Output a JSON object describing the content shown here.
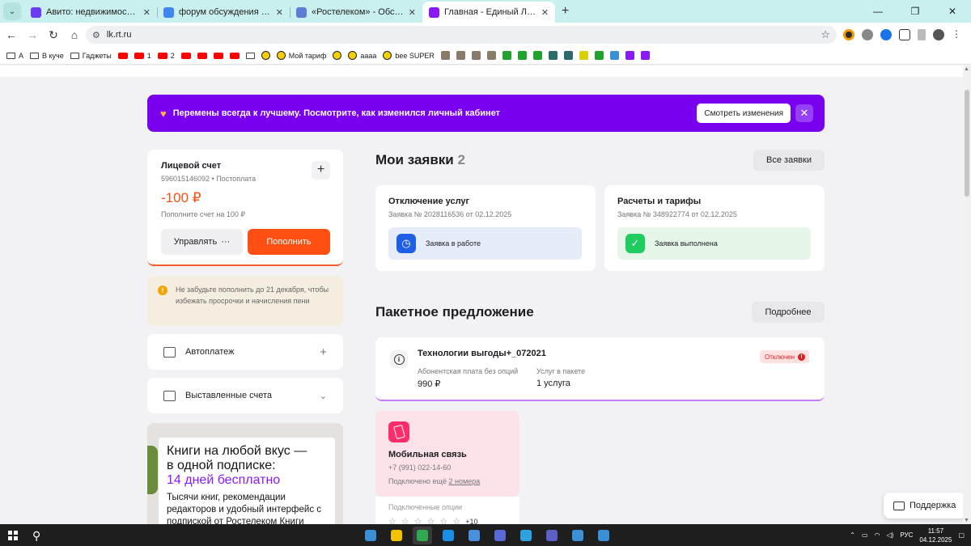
{
  "browser": {
    "tabs": [
      {
        "title": "Авито: недвижимость, транспорт",
        "fav": "#6c3cf4",
        "active": false
      },
      {
        "title": "форум обсуждения операторов",
        "fav": "#4285f4",
        "active": false
      },
      {
        "title": "«Ростелеком» - Обсуждение к",
        "fav": "#5b7fd6",
        "active": false
      },
      {
        "title": "Главная - Единый Личный Каб",
        "fav": "#8a19f5",
        "active": true
      }
    ],
    "new_tab": "+",
    "url": "lk.rt.ru",
    "bookmarks": [
      {
        "type": "folder",
        "label": "А"
      },
      {
        "type": "folder",
        "label": "В куче"
      },
      {
        "type": "folder",
        "label": "Гаджеты"
      },
      {
        "type": "yt",
        "label": ""
      },
      {
        "type": "yt",
        "label": "1"
      },
      {
        "type": "yt",
        "label": "2"
      },
      {
        "type": "yt",
        "label": ""
      },
      {
        "type": "yt",
        "label": ""
      },
      {
        "type": "yt",
        "label": ""
      },
      {
        "type": "yt",
        "label": ""
      },
      {
        "type": "folder",
        "label": ""
      },
      {
        "type": "bee",
        "label": ""
      },
      {
        "type": "bee",
        "label": "Мой тариф"
      },
      {
        "type": "bee",
        "label": ""
      },
      {
        "type": "bee",
        "label": "аааа"
      },
      {
        "type": "bee",
        "label": "bee SUPER"
      },
      {
        "type": "sq",
        "color": "#8a7a6a",
        "label": ""
      },
      {
        "type": "sq",
        "color": "#8a7a6a",
        "label": ""
      },
      {
        "type": "sq",
        "color": "#8a7a6a",
        "label": ""
      },
      {
        "type": "sq",
        "color": "#8a7a6a",
        "label": ""
      },
      {
        "type": "sq",
        "color": "#1fa32c",
        "label": ""
      },
      {
        "type": "sq",
        "color": "#1fa32c",
        "label": ""
      },
      {
        "type": "sq",
        "color": "#1fa32c",
        "label": ""
      },
      {
        "type": "sq",
        "color": "#2c6b6b",
        "label": ""
      },
      {
        "type": "sq",
        "color": "#2c6b6b",
        "label": ""
      },
      {
        "type": "sq",
        "color": "#d8d000",
        "label": ""
      },
      {
        "type": "sq",
        "color": "#1fa32c",
        "label": ""
      },
      {
        "type": "sq",
        "color": "#3a8fd6",
        "label": ""
      },
      {
        "type": "sq",
        "color": "#8a19f5",
        "label": ""
      },
      {
        "type": "sq",
        "color": "#8a19f5",
        "label": ""
      }
    ]
  },
  "banner": {
    "text": "Перемены всегда к лучшему. Посмотрите, как изменился личный кабинет",
    "button": "Смотреть изменения"
  },
  "account": {
    "title": "Лицевой счет",
    "number": "596015146092 • Постоплата",
    "balance": "-100 ₽",
    "hint": "Пополните счет на 100 ₽",
    "manage": "Управлять",
    "topup": "Пополнить"
  },
  "notice": {
    "text": "Не забудьте пополнить до 21 декабря, чтобы избежать просрочки и начисления пени"
  },
  "menu": {
    "autopay": "Автоплатеж",
    "invoices": "Выставленные счета"
  },
  "promo": {
    "heading1": "Книги на любой вкус —",
    "heading2": "в одной подписке:",
    "green": "14 дней бесплатно",
    "text": "Тысячи книг, рекомендации редакторов и удобный интерфейс с подпиской от Ростелеком Книги"
  },
  "requests": {
    "title": "Мои заявки",
    "count": "2",
    "all_button": "Все заявки",
    "items": [
      {
        "title": "Отключение услуг",
        "number": "Заявка № 2028116536 от 02.12.2025",
        "status": "Заявка в работе"
      },
      {
        "title": "Расчеты и тарифы",
        "number": "Заявка № 348922774 от 02.12.2025",
        "status": "Заявка выполнена"
      }
    ]
  },
  "package": {
    "title": "Пакетное предложение",
    "more_button": "Подробнее",
    "name": "Технологии выгоды+_072021",
    "status": "Отключен",
    "fee_label": "Абонентская плата без опций",
    "fee_value": "990 ₽",
    "services_label": "Услуг в пакете",
    "services_value": "1 услуга"
  },
  "mobile": {
    "title": "Мобильная связь",
    "phone": "+7 (991) 022-14-60",
    "more_prefix": "Подключено ещё",
    "more_link": "2 номера",
    "options_label": "Подключенные опции",
    "options_more": "+10"
  },
  "support": {
    "label": "Поддержка"
  },
  "taskbar": {
    "lang": "РУС",
    "time": "11:57",
    "date": "04.12.2025",
    "apps": [
      "#3a8fd6",
      "#f2c300",
      "#2da94f",
      "#1b8fe8",
      "#4a90e2",
      "#5a6ad6",
      "#2aa3e0",
      "#5b5fc7",
      "#3a8fd6",
      "#3a8fd6"
    ]
  },
  "colors": {
    "accent": "#7a00f0",
    "orange": "#ff4f12",
    "blue_status": "#1e5fe6",
    "green_status": "#1fcc5e"
  }
}
